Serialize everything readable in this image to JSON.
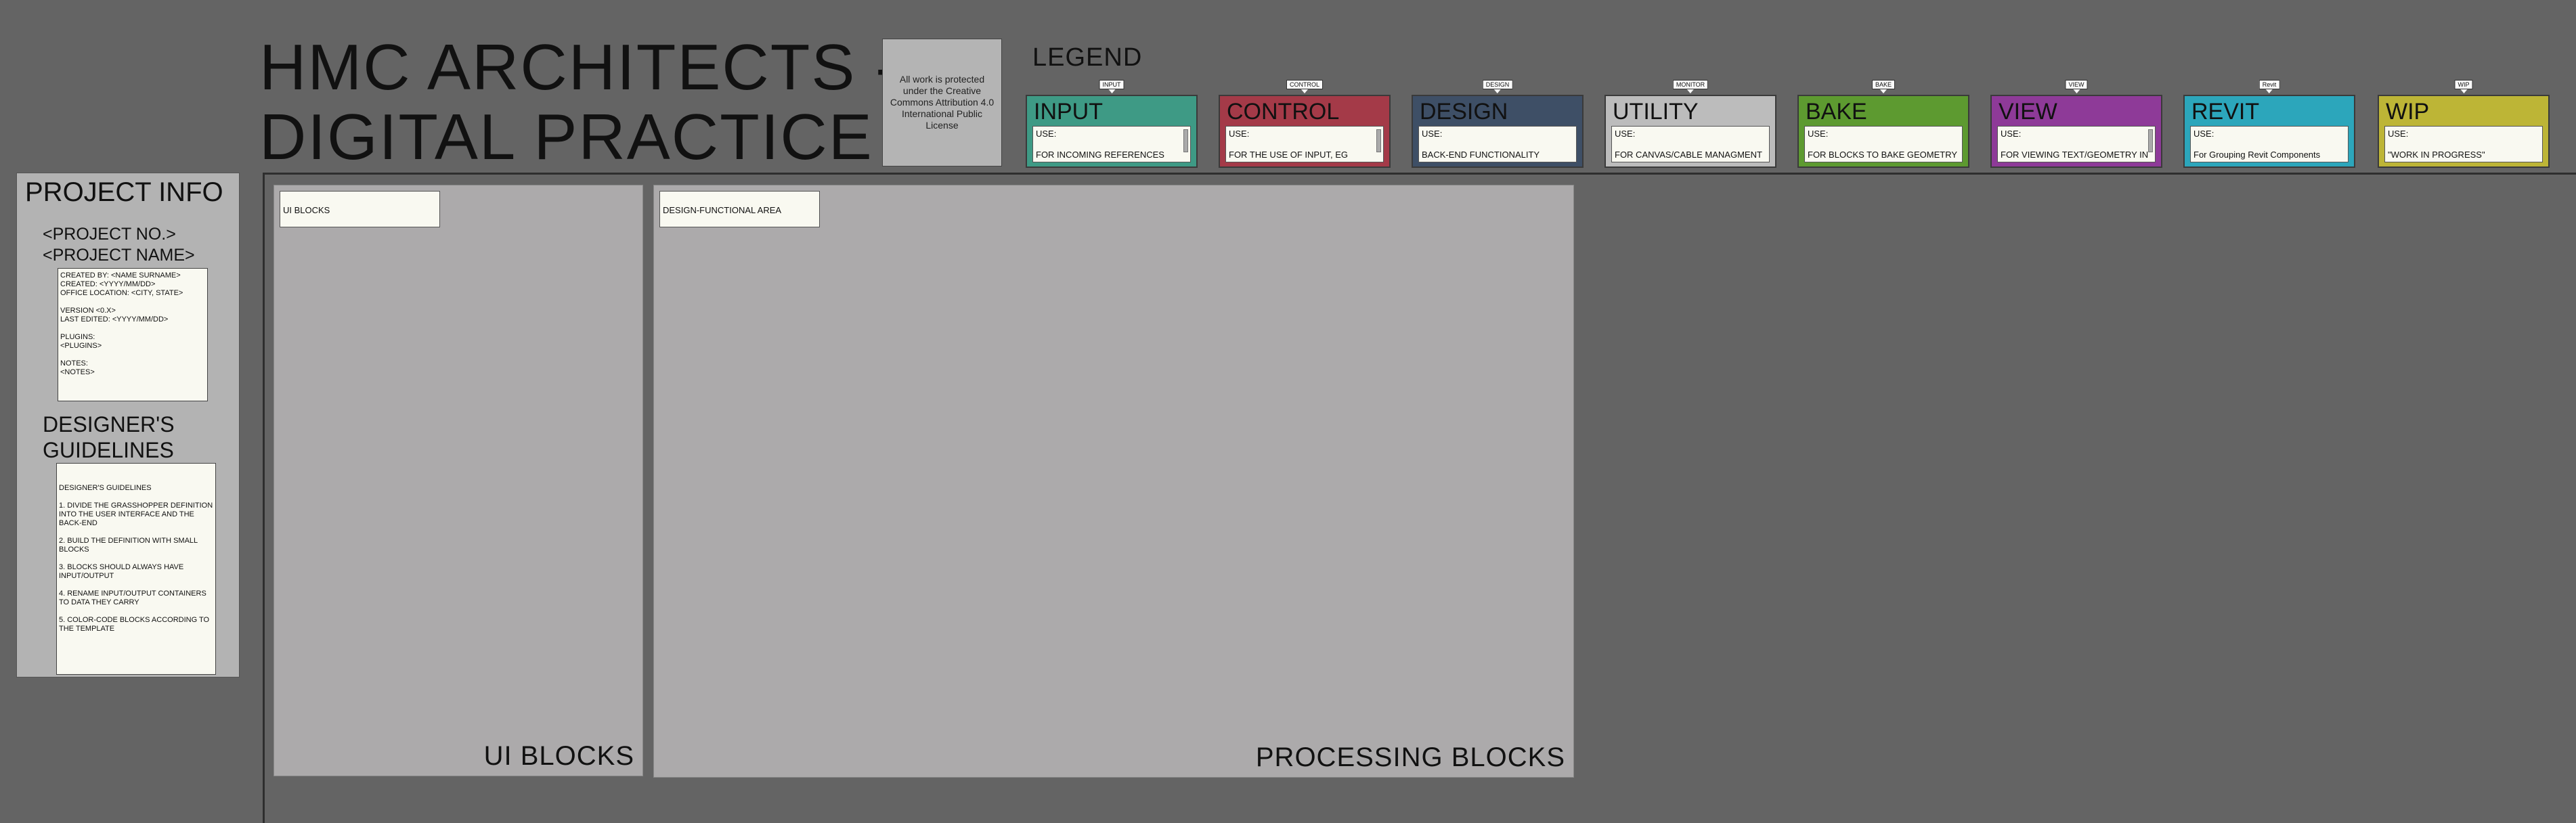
{
  "title": {
    "line1": "HMC ARCHITECTS -",
    "line2": "DIGITAL PRACTICE"
  },
  "license": "All work is protected under the Creative Commons Attribution 4.0 International Public License",
  "legend": {
    "title": "LEGEND",
    "items": [
      {
        "tag": "INPUT",
        "name": "INPUT",
        "use_label": "USE:",
        "desc": "FOR INCOMING REFERENCES",
        "color": "#3e9a85"
      },
      {
        "tag": "CONTROL",
        "name": "CONTROL",
        "use_label": "USE:",
        "desc": "FOR THE USE OF INPUT, EG",
        "color": "#a43a48"
      },
      {
        "tag": "DESIGN",
        "name": "DESIGN",
        "use_label": "USE:",
        "desc": "BACK-END FUNCTIONALITY",
        "color": "#3e4f66"
      },
      {
        "tag": "MONITOR",
        "name": "UTILITY",
        "use_label": "USE:",
        "desc": "FOR CANVAS/CABLE MANAGMENT",
        "color": "#bcbcbc"
      },
      {
        "tag": "BAKE",
        "name": "BAKE",
        "use_label": "USE:",
        "desc": "FOR BLOCKS TO BAKE GEOMETRY",
        "color": "#5d9a30"
      },
      {
        "tag": "VIEW",
        "name": "VIEW",
        "use_label": "USE:",
        "desc": "FOR VIEWING TEXT/GEOMETRY IN",
        "color": "#8e3a98"
      },
      {
        "tag": "Revit",
        "name": "REVIT",
        "use_label": "USE:",
        "desc": "For Grouping Revit Components",
        "color": "#2ca6bb"
      },
      {
        "tag": "WIP",
        "name": "WIP",
        "use_label": "USE:",
        "desc": "\"WORK IN PROGRESS\"",
        "color": "#bdb536"
      }
    ]
  },
  "project_info": {
    "title": "PROJECT INFO",
    "project_no": "<PROJECT NO.>",
    "project_name": "<PROJECT NAME>",
    "details": "CREATED BY: <NAME SURNAME>\nCREATED: <YYYY/MM/DD>\nOFFICE LOCATION: <CITY, STATE>\n\nVERSION <0.X>\nLAST EDITED: <YYYY/MM/DD>\n\nPLUGINS:\n<PLUGINS>\n\nNOTES:\n<NOTES>",
    "guidelines_title": "DESIGNER'S GUIDELINES",
    "guidelines": "DESIGNER'S GUIDELINES\n\n1. DIVIDE THE GRASSHOPPER DEFINITION INTO THE USER INTERFACE AND THE BACK-END\n\n2. BUILD THE DEFINITION WITH SMALL BLOCKS\n\n3. BLOCKS SHOULD ALWAYS HAVE INPUT/OUTPUT\n\n4. RENAME INPUT/OUTPUT CONTAINERS TO DATA THEY CARRY\n\n5. COLOR-CODE BLOCKS ACCORDING TO THE TEMPLATE"
  },
  "groups": {
    "ui": {
      "tag": "UI BLOCKS",
      "label": "UI BLOCKS"
    },
    "processing": {
      "tag": "DESIGN-FUNCTIONAL AREA",
      "label": "PROCESSING BLOCKS"
    }
  }
}
